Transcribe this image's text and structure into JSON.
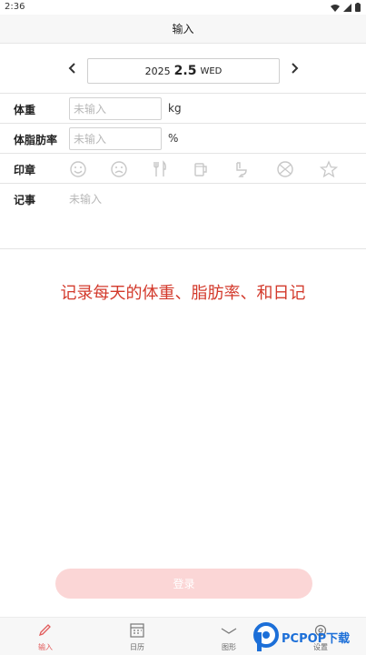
{
  "status_bar": {
    "time": "2:36",
    "icons": [
      "wifi-icon",
      "signal-icon",
      "battery-icon"
    ]
  },
  "header": {
    "title": "输入"
  },
  "date": {
    "year": "2025",
    "month_day": "2.5",
    "weekday": "WED",
    "prev_icon": "chevron-left-icon",
    "next_icon": "chevron-right-icon"
  },
  "weight": {
    "label": "体重",
    "placeholder": "未输入",
    "unit": "kg"
  },
  "body_fat": {
    "label": "体脂肪率",
    "placeholder": "未输入",
    "unit": "%"
  },
  "stamps": {
    "label": "印章",
    "icons": [
      "smile-icon",
      "frown-icon",
      "fork-knife-icon",
      "beer-mug-icon",
      "toilet-icon",
      "ball-icon",
      "star-icon"
    ]
  },
  "notes": {
    "label": "记事",
    "placeholder": "未输入"
  },
  "promo": {
    "text": "记录每天的体重、脂肪率、和日记"
  },
  "login": {
    "label": "登录"
  },
  "tabs": [
    {
      "label": "输入",
      "icon": "pencil-icon",
      "active": true
    },
    {
      "label": "日历",
      "icon": "calendar-icon",
      "active": false
    },
    {
      "label": "图形",
      "icon": "chart-line-icon",
      "active": false
    },
    {
      "label": "设置",
      "icon": "gear-icon",
      "active": false
    }
  ],
  "watermark": {
    "text": "PCPOP下载"
  },
  "colors": {
    "accent": "#e25a5a",
    "promo": "#d33a2c",
    "login_bg": "#fbd6d6",
    "watermark": "#1c6fd8"
  }
}
